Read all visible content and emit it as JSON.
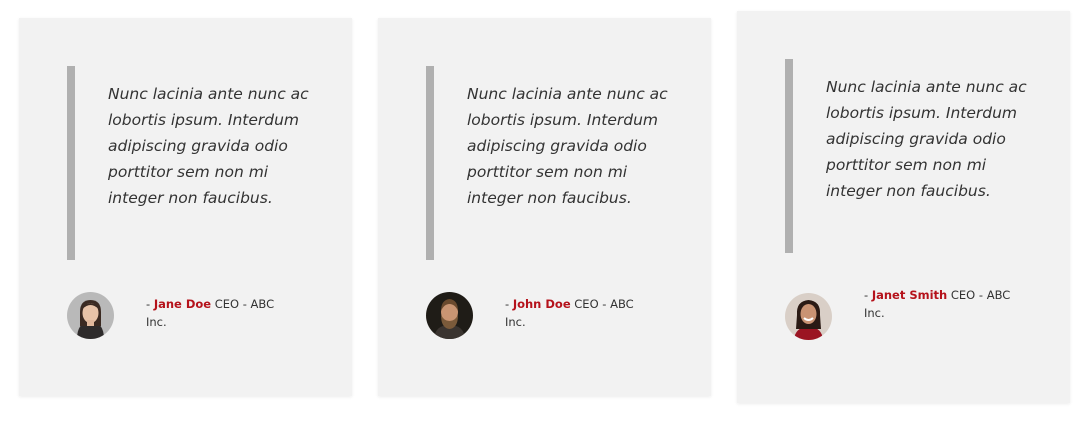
{
  "testimonials": [
    {
      "quote": "Nunc lacinia ante nunc ac lobortis ipsum. Interdum adipiscing gravida odio porttitor sem non mi integer non faucibus.",
      "prefix": "- ",
      "name": "Jane Doe",
      "role": " CEO - ABC Inc."
    },
    {
      "quote": "Nunc lacinia ante nunc ac lobortis ipsum. Interdum adipiscing gravida odio porttitor sem non mi integer non faucibus.",
      "prefix": "- ",
      "name": "John Doe",
      "role": " CEO - ABC Inc."
    },
    {
      "quote": "Nunc lacinia ante nunc ac lobortis ipsum. Interdum adipiscing gravida odio porttitor sem non mi integer non faucibus.",
      "prefix": "- ",
      "name": "Janet Smith",
      "role": " CEO - ABC Inc."
    }
  ],
  "colors": {
    "card_bg": "#f2f2f2",
    "quote_bar": "#b0b0b0",
    "author_name": "#b5121b",
    "text": "#333333"
  },
  "icons": [
    "avatar-jane-doe",
    "avatar-john-doe",
    "avatar-janet-smith"
  ]
}
